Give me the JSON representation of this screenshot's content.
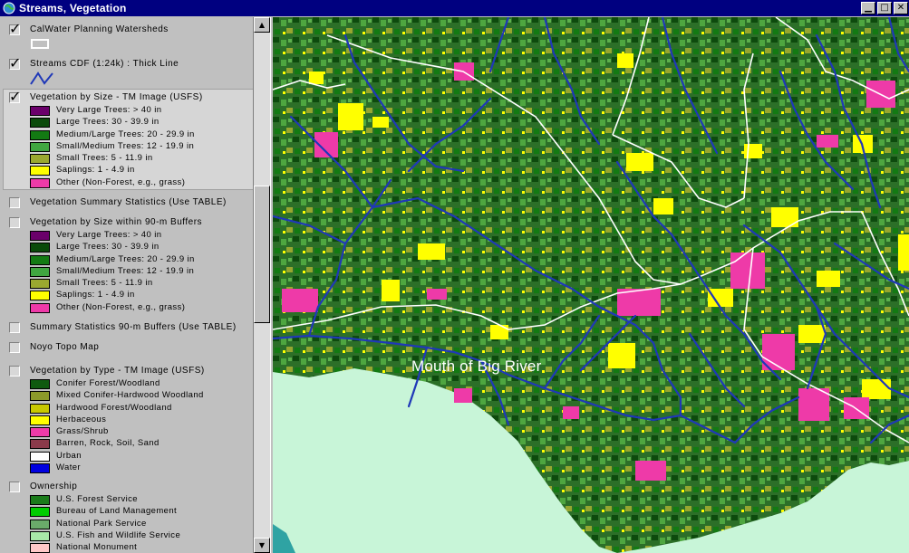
{
  "window": {
    "title": "Streams, Vegetation"
  },
  "colors": {
    "title_bar": "#000080",
    "panel": "#c0c0c0",
    "ocean": "#c8f5d8",
    "stream": "#1f38b8",
    "boundary": "#ffffff"
  },
  "map": {
    "label": "Mouth of Big River",
    "icons": {
      "app": "globe-icon"
    }
  },
  "legend": {
    "themes": [
      {
        "name": "CalWater Planning Watersheds",
        "checked": true,
        "symbol": "polygon-outline"
      },
      {
        "name": "Streams CDF (1:24k) : Thick Line",
        "checked": true,
        "symbol": "line"
      },
      {
        "name": "Vegetation by Size - TM Image (USFS)",
        "checked": true,
        "active": true,
        "classes": [
          {
            "label": "Very Large Trees: > 40  in",
            "color": "#6a006a"
          },
          {
            "label": "Large Trees: 30 - 39.9 in",
            "color": "#0a4a0a"
          },
          {
            "label": "Medium/Large Trees: 20 - 29.9 in",
            "color": "#137a13"
          },
          {
            "label": "Small/Medium Trees: 12 - 19.9 in",
            "color": "#40a640"
          },
          {
            "label": "Small Trees: 5 - 11.9 in",
            "color": "#9aa830"
          },
          {
            "label": "Saplings: 1 - 4.9 in",
            "color": "#ffff00"
          },
          {
            "label": "Other (Non-Forest, e.g., grass)",
            "color": "#ee3aa8"
          }
        ]
      },
      {
        "name": "Vegetation Summary Statistics (Use TABLE)",
        "checked": false
      },
      {
        "name": "Vegetation by Size within 90-m Buffers",
        "checked": false,
        "classes": [
          {
            "label": "Very Large Trees: > 40  in",
            "color": "#6a006a"
          },
          {
            "label": "Large Trees: 30 - 39.9 in",
            "color": "#0a4a0a"
          },
          {
            "label": "Medium/Large Trees: 20 - 29.9 in",
            "color": "#137a13"
          },
          {
            "label": "Small/Medium Trees: 12 - 19.9 in",
            "color": "#40a640"
          },
          {
            "label": "Small Trees: 5 - 11.9 in",
            "color": "#9aa830"
          },
          {
            "label": "Saplings: 1 - 4.9 in",
            "color": "#ffff00"
          },
          {
            "label": "Other (Non-Forest, e.g., grass)",
            "color": "#ee3aa8"
          }
        ]
      },
      {
        "name": "Summary Statistics 90-m Buffers (Use TABLE)",
        "checked": false
      },
      {
        "name": "Noyo Topo Map",
        "checked": false
      },
      {
        "name": "Vegetation by Type - TM Image (USFS)",
        "checked": false,
        "classes": [
          {
            "label": "Conifer Forest/Woodland",
            "color": "#0f5a0f"
          },
          {
            "label": "Mixed Conifer-Hardwood Woodland",
            "color": "#8c9a2a"
          },
          {
            "label": "Hardwood Forest/Woodland",
            "color": "#c8c800"
          },
          {
            "label": "Herbaceous",
            "color": "#ffff00"
          },
          {
            "label": "Grass/Shrub",
            "color": "#ee3aa8"
          },
          {
            "label": "Barren, Rock, Soil, Sand",
            "color": "#8a3a4a"
          },
          {
            "label": "Urban",
            "color": "#ffffff"
          },
          {
            "label": "Water",
            "color": "#0000e0"
          }
        ]
      },
      {
        "name": "Ownership",
        "checked": false,
        "classes": [
          {
            "label": "U.S. Forest Service",
            "color": "#1a7a1a"
          },
          {
            "label": "Bureau of Land Management",
            "color": "#00cc00"
          },
          {
            "label": "National Park Service",
            "color": "#6aaa6a"
          },
          {
            "label": "U.S. Fish and Wildlife Service",
            "color": "#a8e8a8"
          },
          {
            "label": "National Monument",
            "color": "#ffc8c8"
          }
        ]
      }
    ]
  }
}
